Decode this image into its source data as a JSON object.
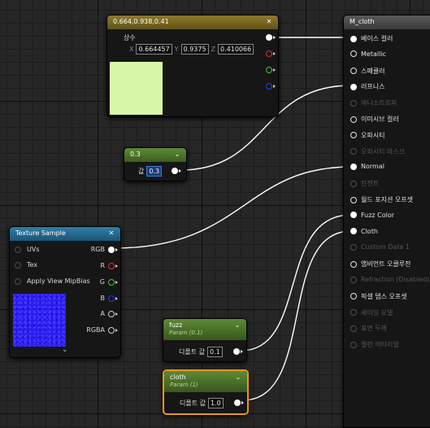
{
  "const3": {
    "title": "0.664,0.938,0.41",
    "subtitle": "상수",
    "x_label": "X",
    "x_value": "0.664457",
    "y_label": "Y",
    "y_value": "0.9375",
    "z_label": "Z",
    "z_value": "0.410066",
    "swatch_color": "#d8f8a8"
  },
  "const1": {
    "title": "0.3",
    "value_label": "값",
    "value": "0.3"
  },
  "texsample": {
    "title": "Texture Sample",
    "inputs": [
      "UVs",
      "Tex",
      "Apply View MipBias"
    ],
    "outputs": [
      "RGB",
      "R",
      "G",
      "B",
      "A",
      "RGBA"
    ],
    "chevron": "⌄"
  },
  "fuzz": {
    "title": "fuzz",
    "subtitle": "Param (0.1)",
    "value_label": "디폴트 값",
    "value": "0.1"
  },
  "cloth": {
    "title": "cloth",
    "subtitle": "Param (1)",
    "value_label": "디폴트 값",
    "value": "1.0"
  },
  "material": {
    "title": "M_cloth",
    "pins": [
      {
        "label": "베이스 컬러",
        "state": "connected"
      },
      {
        "label": "Metallic",
        "state": "active"
      },
      {
        "label": "스페큘러",
        "state": "active"
      },
      {
        "label": "러프니스",
        "state": "connected"
      },
      {
        "label": "애니소트로피",
        "state": "disabled"
      },
      {
        "label": "이미시브 컬러",
        "state": "active"
      },
      {
        "label": "오파시티",
        "state": "active"
      },
      {
        "label": "오파시티 마스크",
        "state": "disabled"
      },
      {
        "label": "Normal",
        "state": "connected"
      },
      {
        "label": "탄젠트",
        "state": "disabled"
      },
      {
        "label": "월드 포지션 오프셋",
        "state": "active"
      },
      {
        "label": "Fuzz Color",
        "state": "connected"
      },
      {
        "label": "Cloth",
        "state": "connected"
      },
      {
        "label": "Custom Data 1",
        "state": "disabled"
      },
      {
        "label": "앰비언트 오클루전",
        "state": "active"
      },
      {
        "label": "Refraction (Disabled)",
        "state": "disabled"
      },
      {
        "label": "픽셀 뎁스 오프셋",
        "state": "active"
      },
      {
        "label": "셰이딩 모델",
        "state": "disabled"
      },
      {
        "label": "표면 두께",
        "state": "disabled"
      },
      {
        "label": "젤런 머티리얼",
        "state": "disabled"
      }
    ]
  },
  "colors": {
    "pin_red": "#e03030",
    "pin_green": "#30d030",
    "pin_blue": "#2040ff",
    "wire": "#ffffff",
    "selection": "#e89a14"
  }
}
